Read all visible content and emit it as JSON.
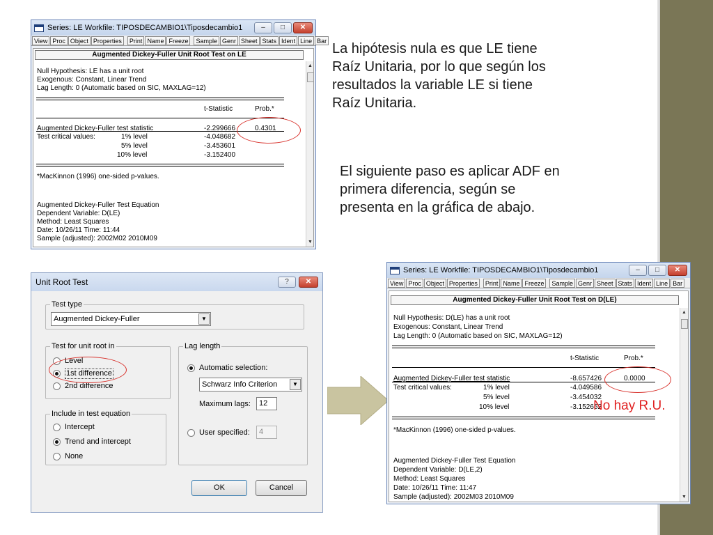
{
  "colors": {
    "sidebar": "#7a7656",
    "arrow": "#c9c4a0",
    "highlight": "#d8322c",
    "no_ru_text": "#e02020"
  },
  "toolbar_items": [
    "View",
    "Proc",
    "Object",
    "Properties",
    "Print",
    "Name",
    "Freeze",
    "Sample",
    "Genr",
    "Sheet",
    "Stats",
    "Ident",
    "Line",
    "Bar"
  ],
  "window1": {
    "title": "Series: LE   Workfile: TIPOSDECAMBIO1\\Tiposdecambio1",
    "header": "Augmented Dickey-Fuller Unit Root Test on LE",
    "null_hypothesis": "Null Hypothesis: LE has a unit root",
    "exogenous": "Exogenous: Constant, Linear Trend",
    "lag_length": "Lag Length: 0 (Automatic based on SIC, MAXLAG=12)",
    "col_tstat": "t-Statistic",
    "col_prob": "Prob.*",
    "adf_label": "Augmented Dickey-Fuller test statistic",
    "adf_t": "-2.299666",
    "adf_prob": "0.4301",
    "critical_label": "Test critical values:",
    "level1_label": "1% level",
    "level1_value": "-4.048682",
    "level5_label": "5% level",
    "level5_value": "-3.453601",
    "level10_label": "10% level",
    "level10_value": "-3.152400",
    "footnote": "*MacKinnon (1996) one-sided p-values.",
    "eq_title": "Augmented Dickey-Fuller Test Equation",
    "dep_var": "Dependent Variable: D(LE)",
    "method": "Method: Least Squares",
    "date": "Date: 10/26/11   Time: 11:44",
    "sample": "Sample (adjusted): 2002M02 2010M09"
  },
  "window2": {
    "title": "Series: LE   Workfile: TIPOSDECAMBIO1\\Tiposdecambio1",
    "header": "Augmented Dickey-Fuller Unit Root Test on D(LE)",
    "null_hypothesis": "Null Hypothesis: D(LE) has a unit root",
    "exogenous": "Exogenous: Constant, Linear Trend",
    "lag_length": "Lag Length: 0 (Automatic based on SIC, MAXLAG=12)",
    "col_tstat": "t-Statistic",
    "col_prob": "Prob.*",
    "adf_label": "Augmented Dickey-Fuller test statistic",
    "adf_t": "-8.657426",
    "adf_prob": "0.0000",
    "critical_label": "Test critical values:",
    "level1_label": "1% level",
    "level1_value": "-4.049586",
    "level5_label": "5% level",
    "level5_value": "-3.454032",
    "level10_label": "10% level",
    "level10_value": "-3.152652",
    "footnote": "*MacKinnon (1996) one-sided p-values.",
    "eq_title": "Augmented Dickey-Fuller Test Equation",
    "dep_var": "Dependent Variable: D(LE,2)",
    "method": "Method: Least Squares",
    "date": "Date: 10/26/11   Time: 11:47",
    "sample": "Sample (adjusted): 2002M03 2010M09"
  },
  "dialog": {
    "title": "Unit Root Test",
    "help_button": "?",
    "test_type_label": "Test type",
    "test_type_value": "Augmented Dickey-Fuller",
    "unit_root_label": "Test for unit root in",
    "opt_level": "Level",
    "opt_first_diff": "1st difference",
    "opt_second_diff": "2nd difference",
    "include_label": "Include in test equation",
    "opt_intercept": "Intercept",
    "opt_trend": "Trend and intercept",
    "opt_none": "None",
    "lag_label": "Lag length",
    "opt_auto": "Automatic selection:",
    "criterion_value": "Schwarz Info Criterion",
    "max_lags_label": "Maximum lags:",
    "max_lags_value": "12",
    "opt_user": "User specified:",
    "user_value": "4",
    "ok": "OK",
    "cancel": "Cancel"
  },
  "text": {
    "paragraph1": [
      "La hipótesis nula es que LE tiene",
      "Raíz Unitaria, por lo que según los",
      "resultados la variable LE si tiene",
      "Raíz Unitaria."
    ],
    "paragraph2": [
      "El siguiente paso es aplicar ADF en",
      "primera diferencia, según se",
      "presenta en la gráfica de abajo."
    ],
    "no_ru": "No hay R.U."
  }
}
